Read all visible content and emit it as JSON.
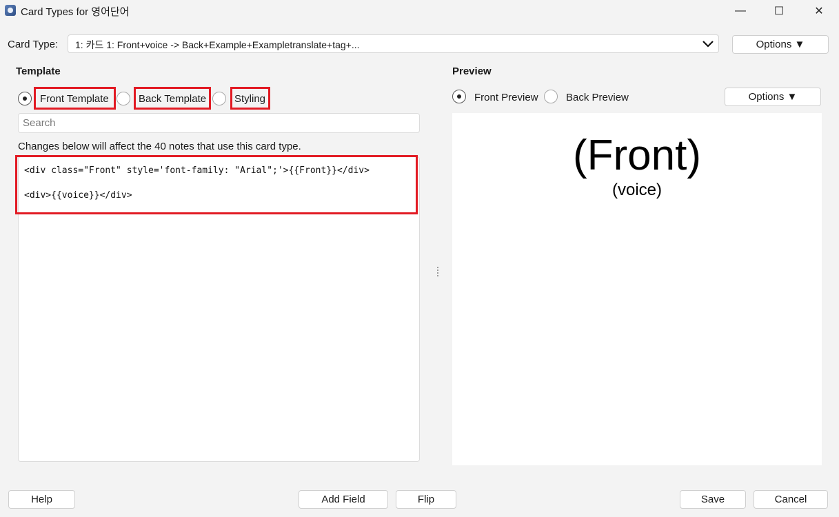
{
  "window": {
    "title": "Card Types for 영어단어",
    "minimize_glyph": "—",
    "maximize_glyph": "☐",
    "close_glyph": "✕"
  },
  "card_type": {
    "label": "Card Type:",
    "selected": "1: 카드 1: Front+voice -> Back+Example+Exampletranslate+tag+...",
    "options_label": "Options ▼"
  },
  "template": {
    "section_title": "Template",
    "radios": [
      {
        "label": "Front Template",
        "checked": true
      },
      {
        "label": "Back Template",
        "checked": false
      },
      {
        "label": "Styling",
        "checked": false
      }
    ],
    "search_placeholder": "Search",
    "notice": "Changes below will affect the 40 notes that use this card type.",
    "code_lines": [
      "<div class=\"Front\" style='font-family: \"Arial\";'>{{Front}}</div>",
      "<div>{{voice}}</div>"
    ]
  },
  "preview": {
    "section_title": "Preview",
    "radios": [
      {
        "label": "Front Preview",
        "checked": true
      },
      {
        "label": "Back Preview",
        "checked": false
      }
    ],
    "options_label": "Options ▼",
    "front_text": "(Front)",
    "voice_text": "(voice)"
  },
  "footer": {
    "help": "Help",
    "add_field": "Add Field",
    "flip": "Flip",
    "save": "Save",
    "cancel": "Cancel"
  },
  "colors": {
    "highlight": "#e21a23",
    "background": "#f3f3f3"
  }
}
